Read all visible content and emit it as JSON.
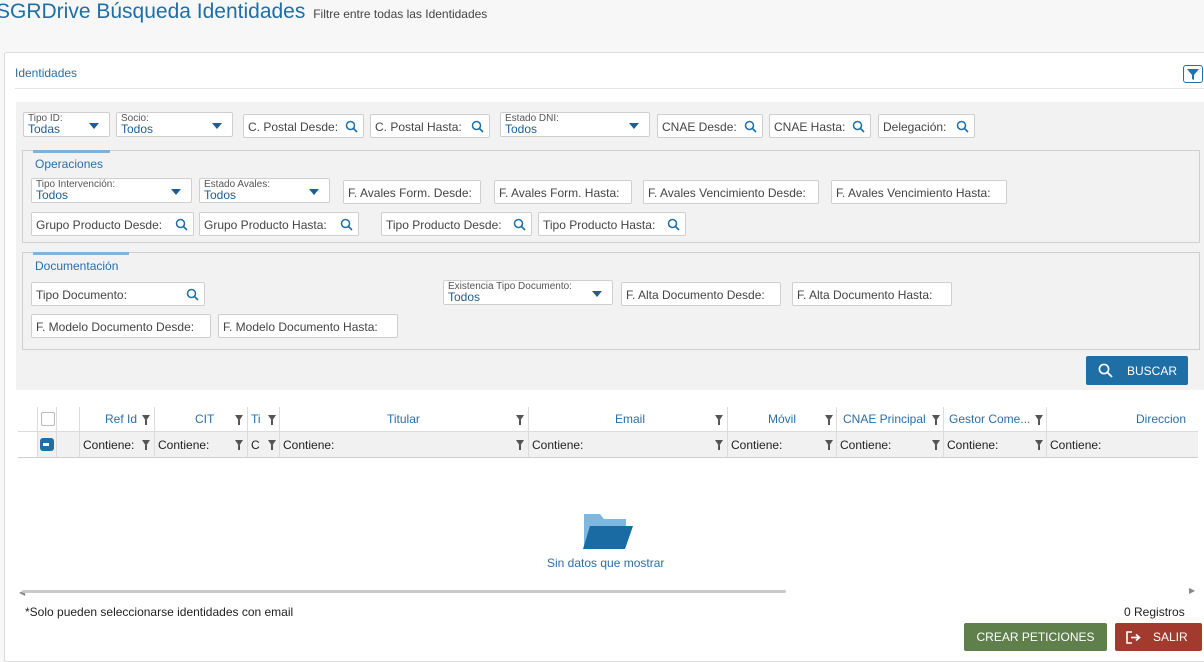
{
  "header": {
    "title": "SGRDrive Búsqueda Identidades",
    "subtitle": "Filtre entre todas las Identidades"
  },
  "panel": {
    "title": "Identidades"
  },
  "filters": {
    "tipo_id": {
      "label": "Tipo ID:",
      "value": "Todas"
    },
    "socio": {
      "label": "Socio:",
      "value": "Todos"
    },
    "cp_desde": "C. Postal Desde:",
    "cp_hasta": "C. Postal Hasta:",
    "estado_dni": {
      "label": "Estado DNI:",
      "value": "Todos"
    },
    "cnae_desde": "CNAE Desde:",
    "cnae_hasta": "CNAE Hasta:",
    "delegacion": "Delegación:"
  },
  "operaciones": {
    "title": "Operaciones",
    "tipo_intervencion": {
      "label": "Tipo Intervención:",
      "value": "Todos"
    },
    "estado_avales": {
      "label": "Estado Avales:",
      "value": "Todos"
    },
    "f_avales_form_desde": "F. Avales Form. Desde:",
    "f_avales_form_hasta": "F. Avales Form. Hasta:",
    "f_avales_venc_desde": "F. Avales Vencimiento Desde:",
    "f_avales_venc_hasta": "F. Avales Vencimiento Hasta:",
    "grupo_producto_desde": "Grupo Producto Desde:",
    "grupo_producto_hasta": "Grupo Producto Hasta:",
    "tipo_producto_desde": "Tipo Producto Desde:",
    "tipo_producto_hasta": "Tipo Producto Hasta:"
  },
  "documentacion": {
    "title": "Documentación",
    "tipo_documento": "Tipo Documento:",
    "existencia_tipo_documento": {
      "label": "Existencia Tipo Documento:",
      "value": "Todos"
    },
    "f_alta_doc_desde": "F. Alta Documento Desde:",
    "f_alta_doc_hasta": "F. Alta Documento Hasta:",
    "f_modelo_doc_desde": "F. Modelo Documento Desde:",
    "f_modelo_doc_hasta": "F. Modelo Documento Hasta:"
  },
  "buscar_label": "BUSCAR",
  "grid": {
    "columns": [
      "Ref Id",
      "CIT",
      "Ti",
      "Titular",
      "Email",
      "Móvil",
      "CNAE Principal",
      "Gestor Come...",
      "Direccion"
    ],
    "filter_values": [
      "Contiene:",
      "Contiene:",
      "C",
      "Contiene:",
      "Contiene:",
      "Contiene:",
      "Contiene:",
      "Contiene:",
      "Contiene:"
    ]
  },
  "empty_text": "Sin datos que mostrar",
  "footer": {
    "note": "*Solo pueden seleccionarse identidades con email",
    "count": "0 Registros",
    "crear": "CREAR PETICIONES",
    "salir": "SALIR"
  },
  "colors": {
    "primary": "#1e6fa6",
    "crear": "#5f7f4b",
    "salir": "#a33a2e"
  }
}
